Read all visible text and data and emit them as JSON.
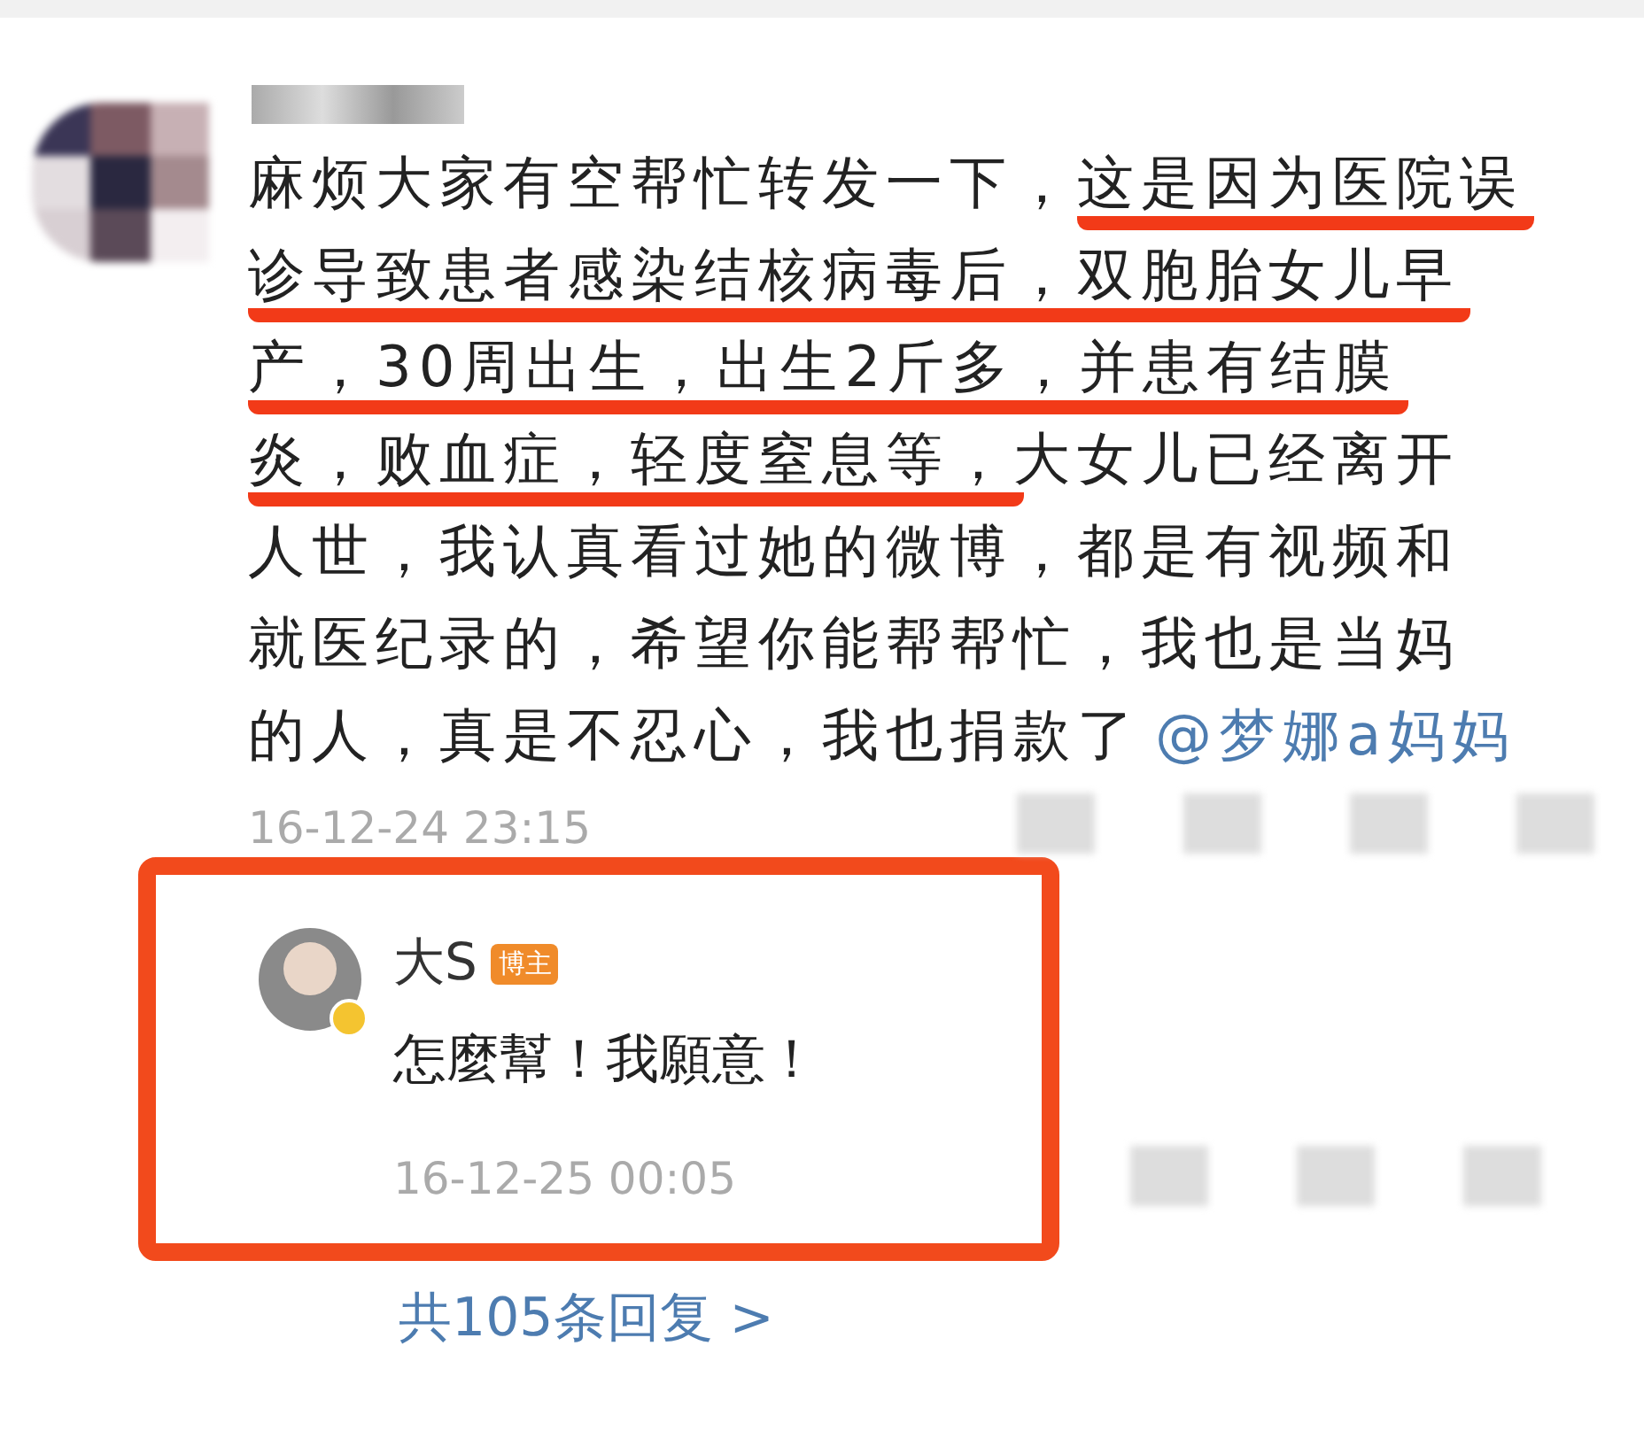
{
  "comment": {
    "lines": [
      [
        {
          "kind": "text",
          "text": "麻烦大家有空帮忙转发一下，"
        },
        {
          "kind": "marked",
          "text": "这是因为医院误"
        }
      ],
      [
        {
          "kind": "marked",
          "text": "诊导致患者感染结核病毒后，双胞胎女儿早"
        }
      ],
      [
        {
          "kind": "marked",
          "text": "产，30周出生，出生2斤多，并患有结膜"
        }
      ],
      [
        {
          "kind": "marked",
          "text": "炎，败血症，轻度窒息等，"
        },
        {
          "kind": "text",
          "text": "大女儿已经离开"
        }
      ],
      [
        {
          "kind": "text",
          "text": "人世，我认真看过她的微博，都是有视频和"
        }
      ],
      [
        {
          "kind": "text",
          "text": "就医纪录的，希望你能帮帮忙，我也是当妈"
        }
      ],
      [
        {
          "kind": "text",
          "text": "的人，真是不忍心，我也捐款了"
        },
        {
          "kind": "mention",
          "text": "@梦娜a妈妈"
        }
      ]
    ],
    "time": "16-12-24 23:15",
    "reply": {
      "name": "大S",
      "badge": "博主",
      "verified": true,
      "text": "怎麼幫！我願意！",
      "time": "16-12-25 00:05",
      "highlighted": true
    },
    "replies_link": "共105条回复 >"
  }
}
